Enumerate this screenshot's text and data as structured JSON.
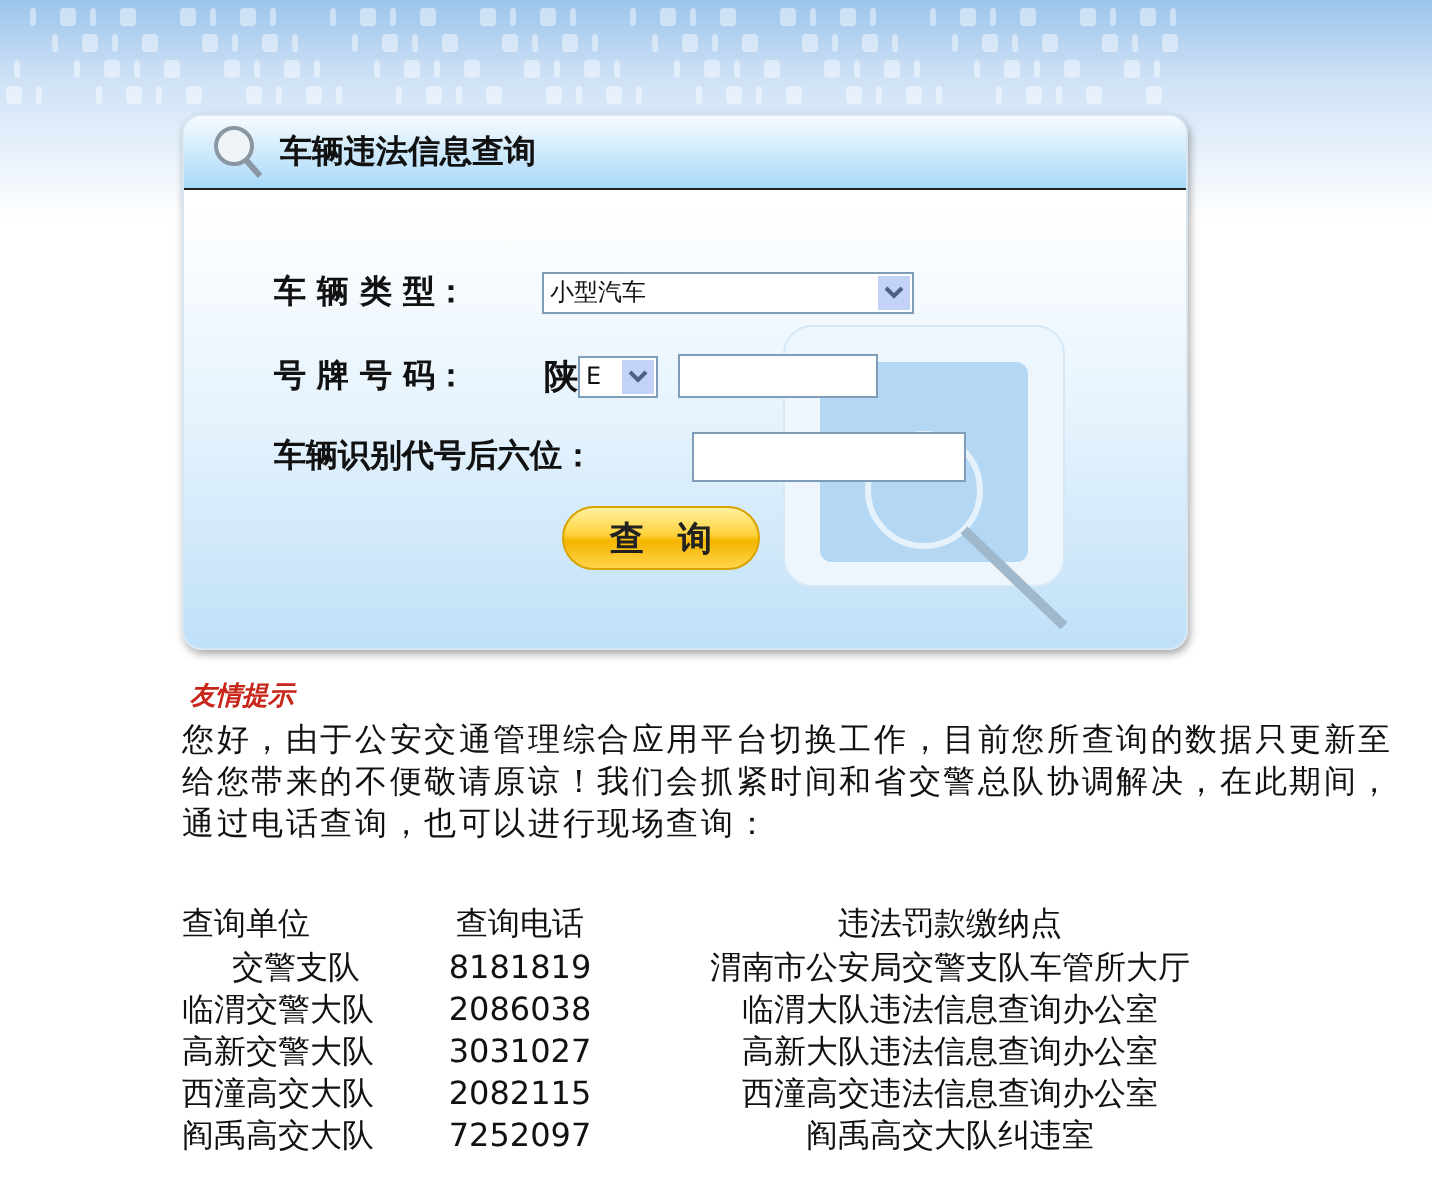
{
  "panel": {
    "title": "车辆违法信息查询"
  },
  "form": {
    "vehicle_type": {
      "label": "车 辆 类 型：",
      "value": "小型汽车"
    },
    "plate": {
      "label": "号 牌 号 码：",
      "province": "陕",
      "letter": "E"
    },
    "vin": {
      "label": "车辆识别代号后六位："
    },
    "submit": "查　询"
  },
  "notice": {
    "title": "友情提示",
    "lines": [
      "您好，由于公安交通管理综合应用平台切换工作，目前您所查询的数据只更新至",
      "给您带来的不便敬请原谅！我们会抓紧时间和省交警总队协调解决，在此期间，",
      "通过电话查询，也可以进行现场查询："
    ]
  },
  "table": {
    "columns": [
      "查询单位",
      "查询电话",
      "违法罚款缴纳点"
    ],
    "rows": [
      [
        "交警支队",
        "8181819",
        "渭南市公安局交警支队车管所大厅"
      ],
      [
        "临渭交警大队",
        "2086038",
        "临渭大队违法信息查询办公室"
      ],
      [
        "高新交警大队",
        "3031027",
        "高新大队违法信息查询办公室"
      ],
      [
        "西潼高交大队",
        "2082115",
        "西潼高交违法信息查询办公室"
      ],
      [
        "阎禹高交大队",
        "7252097",
        "阎禹高交大队纠违室"
      ]
    ]
  }
}
